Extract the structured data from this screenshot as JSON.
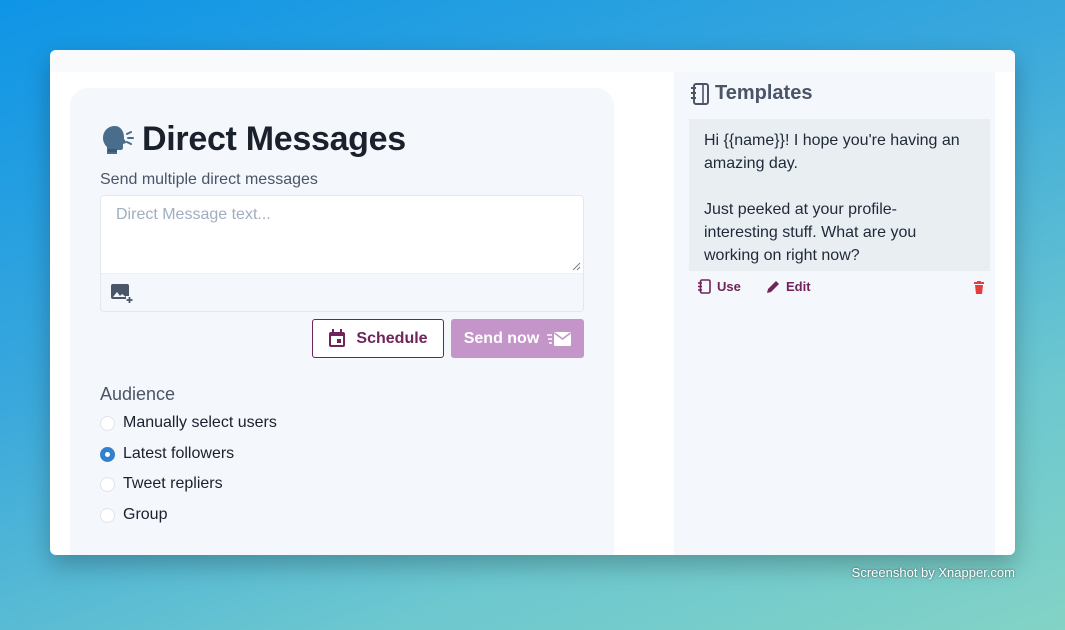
{
  "compose": {
    "title": "Direct Messages",
    "subtitle": "Send multiple direct messages",
    "message_placeholder": "Direct Message text...",
    "schedule_label": "Schedule",
    "send_label": "Send now"
  },
  "audience": {
    "label": "Audience",
    "options": [
      {
        "label": "Manually select users",
        "checked": false
      },
      {
        "label": "Latest followers",
        "checked": true
      },
      {
        "label": "Tweet repliers",
        "checked": false
      },
      {
        "label": "Group",
        "checked": false
      }
    ]
  },
  "templates": {
    "title": "Templates",
    "items": [
      {
        "text": "Hi {{name}}! I hope you're having an amazing day.\n\nJust peeked at your profile- interesting stuff. What are you working on right now?",
        "use_label": "Use",
        "edit_label": "Edit"
      }
    ]
  },
  "watermark": "Screenshot by Xnapper.com",
  "colors": {
    "accent": "#702459",
    "send_button_bg": "#c495c9",
    "radio_checked": "#3182ce",
    "trash": "#e53e3e"
  },
  "icons": {
    "title": "speaking-head-icon",
    "image": "add-image-icon",
    "schedule": "calendar-icon",
    "send": "send-mail-icon",
    "templates": "notebook-icon",
    "use": "notebook-icon",
    "edit": "pencil-icon",
    "delete": "trash-icon"
  }
}
